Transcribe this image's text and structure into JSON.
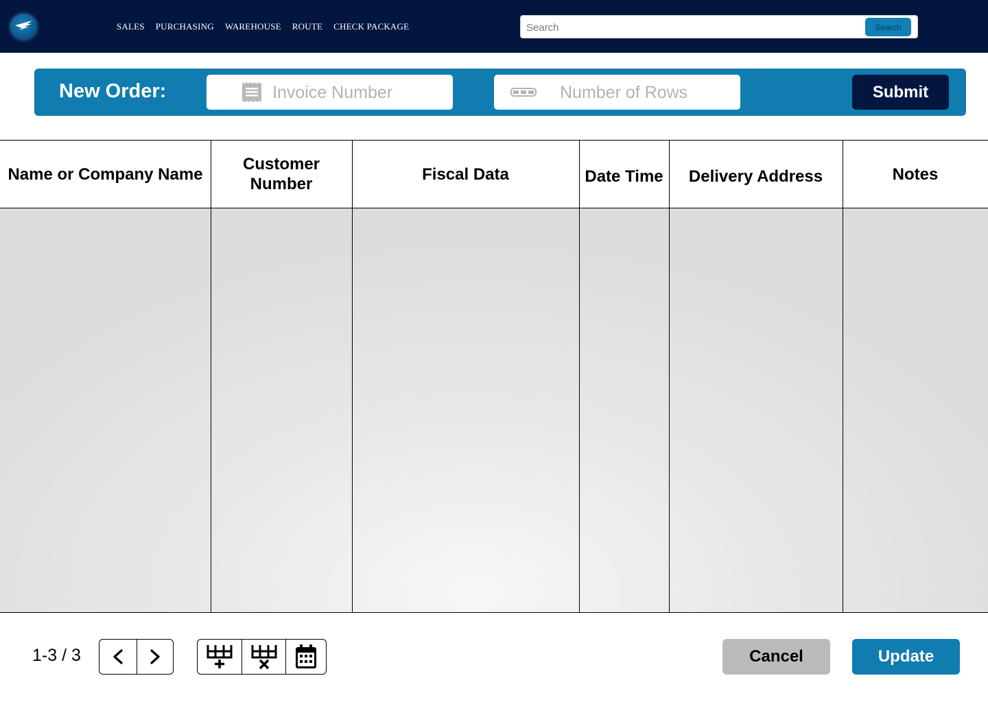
{
  "header": {
    "logo_icon": "wing-logo-icon",
    "nav": [
      {
        "label": "SALES"
      },
      {
        "label": "PURCHASING"
      },
      {
        "label": "WAREHOUSE"
      },
      {
        "label": "ROUTE"
      },
      {
        "label": "CHECK PACKAGE"
      }
    ],
    "search": {
      "placeholder": "Search",
      "button_label": "Search"
    }
  },
  "order_bar": {
    "title": "New Order:",
    "invoice": {
      "placeholder": "Invoice Number",
      "icon": "receipt-icon"
    },
    "rows": {
      "placeholder": "Number of Rows",
      "icon": "rows-icon"
    },
    "submit_label": "Submit"
  },
  "table": {
    "columns": [
      {
        "label": "Name or Company Name"
      },
      {
        "label": "Customer Number"
      },
      {
        "label": "Fiscal Data"
      },
      {
        "label": "Date Time"
      },
      {
        "label": "Delivery Address"
      },
      {
        "label": "Notes"
      }
    ],
    "rows": []
  },
  "footer": {
    "pagination": "1-3 / 3",
    "prev_icon": "chevron-left-icon",
    "next_icon": "chevron-right-icon",
    "tools": [
      {
        "icon": "add-row-icon"
      },
      {
        "icon": "delete-row-icon"
      },
      {
        "icon": "calendar-icon"
      }
    ],
    "cancel_label": "Cancel",
    "update_label": "Update"
  },
  "colors": {
    "navbar": "#031640",
    "accent": "#107caf",
    "cancel": "#bdbaba"
  }
}
